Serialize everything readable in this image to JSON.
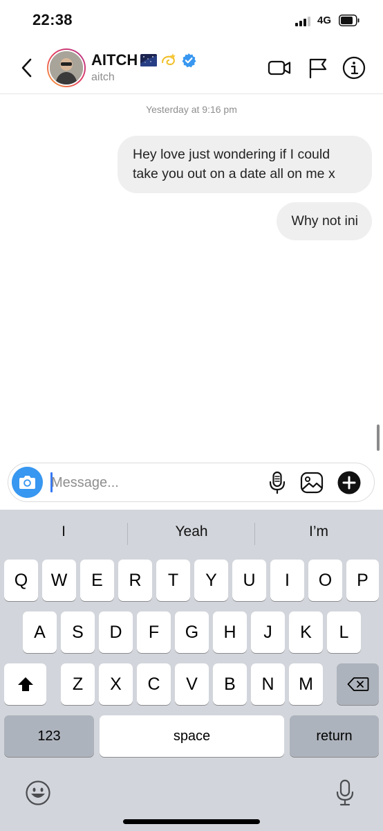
{
  "status_bar": {
    "time": "22:38",
    "network": "4G",
    "icons": [
      "signal-bars-icon",
      "battery-icon"
    ]
  },
  "header": {
    "back_icon": "chevron-left-icon",
    "name": "AITCH",
    "name_emojis": [
      "night-sky-emoji",
      "dizzy-emoji"
    ],
    "verified_icon": "verified-badge-icon",
    "handle": "aitch",
    "actions": [
      "video-call-icon",
      "flag-icon",
      "info-icon"
    ]
  },
  "thread": {
    "timestamp": "Yesterday at 9:16 pm",
    "messages": [
      {
        "from": "me",
        "text": "Hey love just wondering if I could take you out on a date all on me x"
      },
      {
        "from": "me",
        "text": "Why not ini"
      }
    ]
  },
  "composer": {
    "placeholder": "Message...",
    "value": "",
    "icons": [
      "camera-icon",
      "microphone-icon",
      "gallery-icon",
      "plus-icon"
    ]
  },
  "keyboard": {
    "suggestions": [
      "I",
      "Yeah",
      "I’m"
    ],
    "rows": [
      [
        "Q",
        "W",
        "E",
        "R",
        "T",
        "Y",
        "U",
        "I",
        "O",
        "P"
      ],
      [
        "A",
        "S",
        "D",
        "F",
        "G",
        "H",
        "J",
        "K",
        "L"
      ],
      [
        "Z",
        "X",
        "C",
        "V",
        "B",
        "N",
        "M"
      ]
    ],
    "numbers_label": "123",
    "space_label": "space",
    "return_label": "return",
    "icons": [
      "shift-icon",
      "backspace-icon",
      "emoji-icon",
      "dictation-icon"
    ]
  },
  "colors": {
    "accent_blue": "#3897f0",
    "verified_blue": "#3897f0",
    "bubble_grey": "#efefef",
    "keyboard_bg": "#d2d5db",
    "key_fn": "#adb3bc"
  }
}
